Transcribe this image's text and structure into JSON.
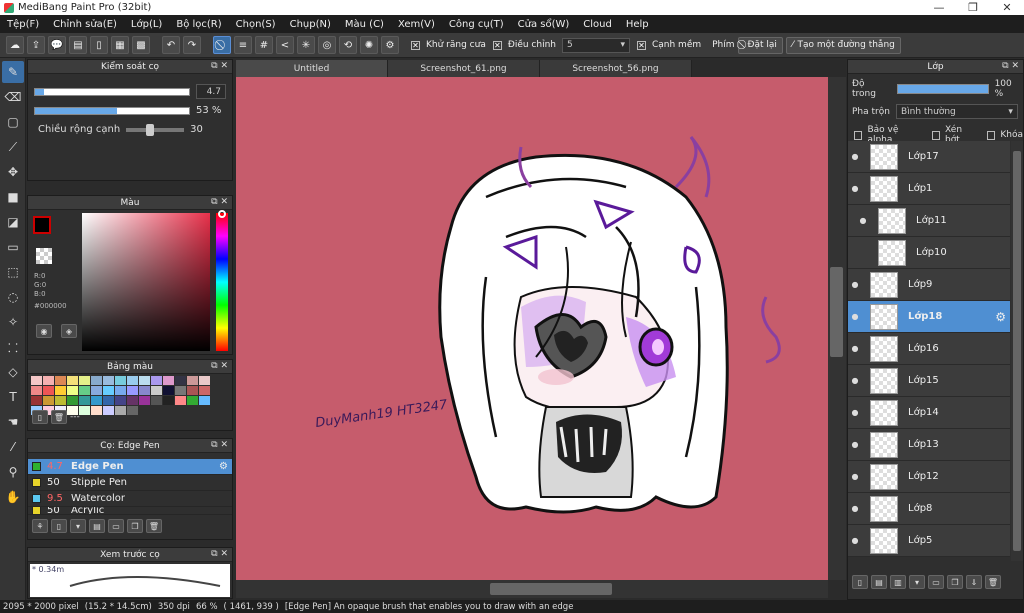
{
  "title": "MediBang Paint Pro (32bit)",
  "menu": [
    "Tệp(F)",
    "Chỉnh sửa(E)",
    "Lớp(L)",
    "Bộ lọc(R)",
    "Chọn(S)",
    "Chụp(N)",
    "Màu (C)",
    "Xem(V)",
    "Công cụ(T)",
    "Cửa sổ(W)",
    "Cloud",
    "Help"
  ],
  "toolbar": {
    "antialias_label": "Khử răng cưa",
    "adjust_label": "Điều chỉnh",
    "adjust_value": "5",
    "soft_label": "Cạnh mềm",
    "key_label": "Phím",
    "reset_label": "Đặt lại",
    "straight_label": "Tạo một đường thẳng"
  },
  "tabs": [
    "Untitled",
    "Screenshot_61.png",
    "Screenshot_56.png"
  ],
  "brush_control": {
    "title": "Kiểm soát cọ",
    "size_value": "4.7",
    "size_fill": 0.06,
    "opacity_value": "53 %",
    "opacity_fill": 0.53,
    "edge_label": "Chiều rộng cạnh",
    "edge_value": "30"
  },
  "color": {
    "title": "Màu",
    "r": "R:0",
    "g": "G:0",
    "b": "B:0",
    "hex": "#000000"
  },
  "palette": {
    "title": "Bảng màu",
    "extra": "---",
    "colors": [
      "#f5c7c7",
      "#f5b0b0",
      "#d85",
      "#f3e07a",
      "#e5f08a",
      "#8ac",
      "#9bd",
      "#7cd",
      "#9ce",
      "#bde",
      "#a9e",
      "#d9c",
      "#334",
      "#c99",
      "#e9c9c9",
      "#e88",
      "#e55",
      "#fc3",
      "#ef8",
      "#6c8",
      "#8ad",
      "#6cf",
      "#7ae",
      "#99f",
      "#88c",
      "#ccc",
      "#113",
      "#777",
      "#a55",
      "#c66",
      "#933",
      "#c93",
      "#bb3",
      "#393",
      "#399",
      "#39c",
      "#36a",
      "#448",
      "#636",
      "#939",
      "#555",
      "#222",
      "#f88",
      "#3a3",
      "#6bf",
      "#9cf",
      "#fcd",
      "#eef",
      "#ffe",
      "#dfd",
      "#fdc",
      "#ccf",
      "#aaa",
      "#666"
    ]
  },
  "brush": {
    "title": "Cọ: Edge Pen",
    "items": [
      {
        "size": "4.7",
        "name": "Edge Pen",
        "color": "#2fb02f"
      },
      {
        "size": "50",
        "name": "Stipple Pen",
        "color": "#e8d42a"
      },
      {
        "size": "9.5",
        "name": "Watercolor",
        "color": "#5bc8f0"
      },
      {
        "size": "50",
        "name": "Acrylic",
        "color": "#e8d42a"
      }
    ]
  },
  "preview": {
    "title": "Xem trước cọ",
    "label": "* 0.34m"
  },
  "layer_panel": {
    "title": "Lớp",
    "opacity_label": "Độ trong",
    "opacity_value": "100 %",
    "opacity_fill": 1.0,
    "blend_label": "Pha trộn",
    "blend_value": "Bình thường",
    "protect_alpha": "Bảo vệ alpha",
    "clip": "Xén bớt",
    "lock": "Khóa",
    "layers": [
      "Lớp17",
      "Lớp1",
      "Lớp11",
      "Lớp10",
      "Lớp9",
      "Lớp18",
      "Lớp16",
      "Lớp15",
      "Lớp14",
      "Lớp13",
      "Lớp12",
      "Lớp8",
      "Lớp5"
    ]
  },
  "status": {
    "size": "2095 * 2000 pixel",
    "cm": "(15.2 * 14.5cm)",
    "dpi": "350 dpi",
    "zoom": "66 %",
    "coords": "( 1461, 939 )",
    "hint": "[Edge Pen] An opaque brush that enables you to draw with an edge"
  },
  "signature": "DuyManh19 HT3247"
}
